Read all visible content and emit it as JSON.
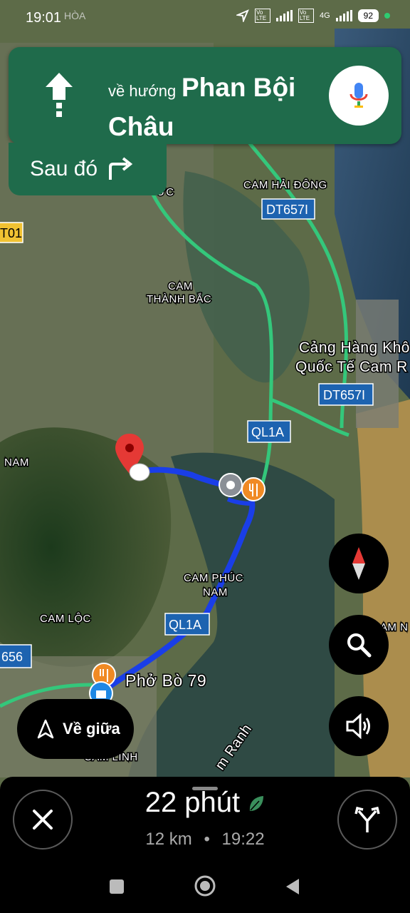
{
  "status_bar": {
    "time": "19:01",
    "location_fragment": "HÒA",
    "network_4g": "4G",
    "battery": "92",
    "volte_badges": [
      "Vo LTE",
      "Vo LTE"
    ]
  },
  "nav_instruction": {
    "prefix": "về hướng",
    "street": "Phan Bội Châu",
    "maneuver_icon": "straight-arrow"
  },
  "then_instruction": {
    "label": "Sau đó",
    "maneuver_icon": "turn-right-arrow"
  },
  "map": {
    "labels": {
      "cam_hai_dong": "CAM HẢI ĐÔNG",
      "cam_thanh_bac_1": "CAM",
      "cam_thanh_bac_2": "THÀNH BẮC",
      "cam_phuc_nam_1": "CAM PHÚC",
      "cam_phuc_nam_2": "NAM",
      "cam_loc": "CAM LỘC",
      "cam_linh": "CAM LINH",
      "airport_1": "Cảng Hàng Khô",
      "airport_2": "Quốc Tế Cam R",
      "nam_left": "NAM",
      "am_n_right": "AM N",
      "cam_ranh_water": "m Ranh",
      "poi_pho_bo": "Phở Bò 79",
      "partial_uc": "ỨC"
    },
    "shields": {
      "dt657_top": "DT657I",
      "dt657_mid": "DT657I",
      "ql1a_top": "QL1A",
      "ql1a_bottom": "QL1A",
      "t01": "T01",
      "r656": "656"
    }
  },
  "controls": {
    "recenter_label": "Về giữa",
    "compass_icon": "compass-icon",
    "search_icon": "search-icon",
    "sound_icon": "volume-icon"
  },
  "trip": {
    "duration": "22 phút",
    "distance": "12 km",
    "separator": "•",
    "arrival": "19:22"
  },
  "colors": {
    "nav_green": "#1f6b4b",
    "route_blue": "#1a3ee8",
    "traffic_green": "#34c77b"
  }
}
